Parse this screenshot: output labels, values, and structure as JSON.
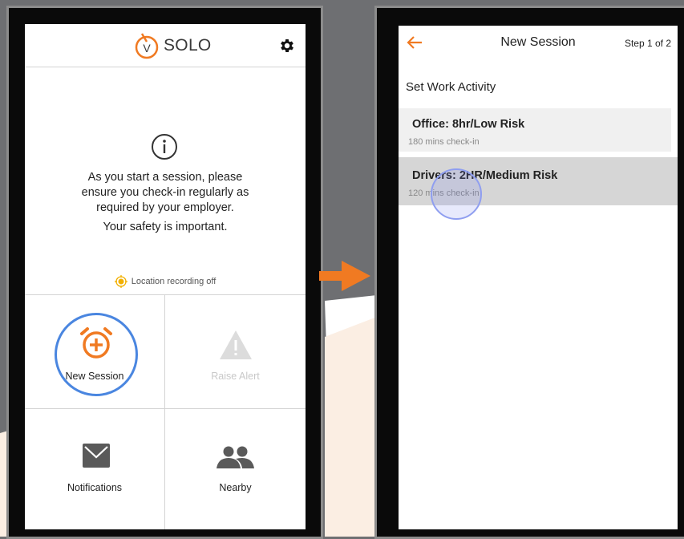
{
  "left_screen": {
    "logo_letter": "V",
    "logo_text": "SOLO",
    "info_message": [
      "As you start a session, please",
      "ensure you check-in regularly as",
      "required by your employer."
    ],
    "safety_message": "Your safety is important.",
    "location_status": "Location recording off",
    "actions": [
      {
        "label": "New Session",
        "icon": "alarm-plus-icon",
        "enabled": true
      },
      {
        "label": "Raise Alert",
        "icon": "warning-triangle-icon",
        "enabled": false
      },
      {
        "label": "Notifications",
        "icon": "envelope-icon",
        "enabled": true
      },
      {
        "label": "Nearby",
        "icon": "people-icon",
        "enabled": true
      }
    ]
  },
  "right_screen": {
    "title": "New Session",
    "step": "Step 1 of 2",
    "section_title": "Set Work Activity",
    "activities": [
      {
        "title": "Office: 8hr/Low Risk",
        "subtitle": "180 mins check-in",
        "selected": false
      },
      {
        "title": "Drivers: 2HR/Medium Risk",
        "subtitle": "120 mins check-in",
        "selected": true
      }
    ]
  },
  "colors": {
    "accent": "#f07a22",
    "highlight_ring": "#4a86e0",
    "tap_ring": "#8f9ef0",
    "background": "#6e6f72"
  }
}
